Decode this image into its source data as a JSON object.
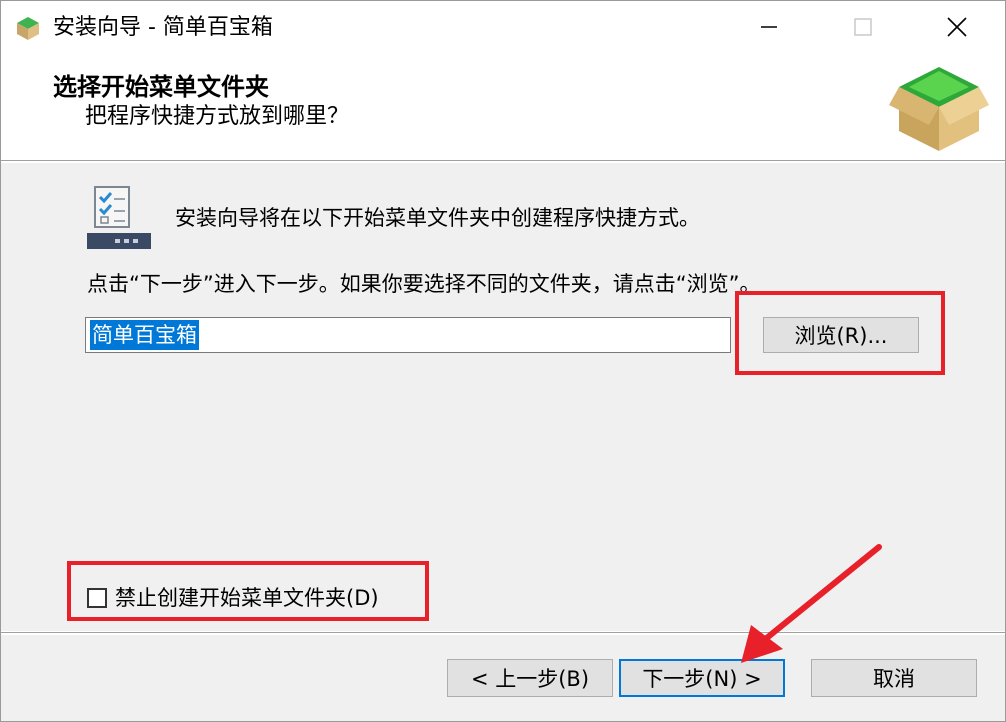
{
  "window": {
    "title": "安装向导 - 简单百宝箱",
    "minimize_icon": "minimize-icon",
    "maximize_icon": "maximize-icon",
    "close_icon": "close-icon"
  },
  "header": {
    "title": "选择开始菜单文件夹",
    "subtitle": "把程序快捷方式放到哪里？",
    "icon": "package-box-icon"
  },
  "main": {
    "intro": "安装向导将在以下开始菜单文件夹中创建程序快捷方式。",
    "hint": "点击“下一步”进入下一步。如果你要选择不同的文件夹，请点击“浏览”。",
    "folder_value": "简单百宝箱",
    "browse_label": "浏览(R)...",
    "checkbox_label": "禁止创建开始菜单文件夹(D)",
    "checkbox_checked": false
  },
  "footer": {
    "back_label": "< 上一步(B)",
    "next_label": "下一步(N) >",
    "cancel_label": "取消"
  },
  "annotation_color": "#e8202a",
  "accent_color": "#0078d7"
}
